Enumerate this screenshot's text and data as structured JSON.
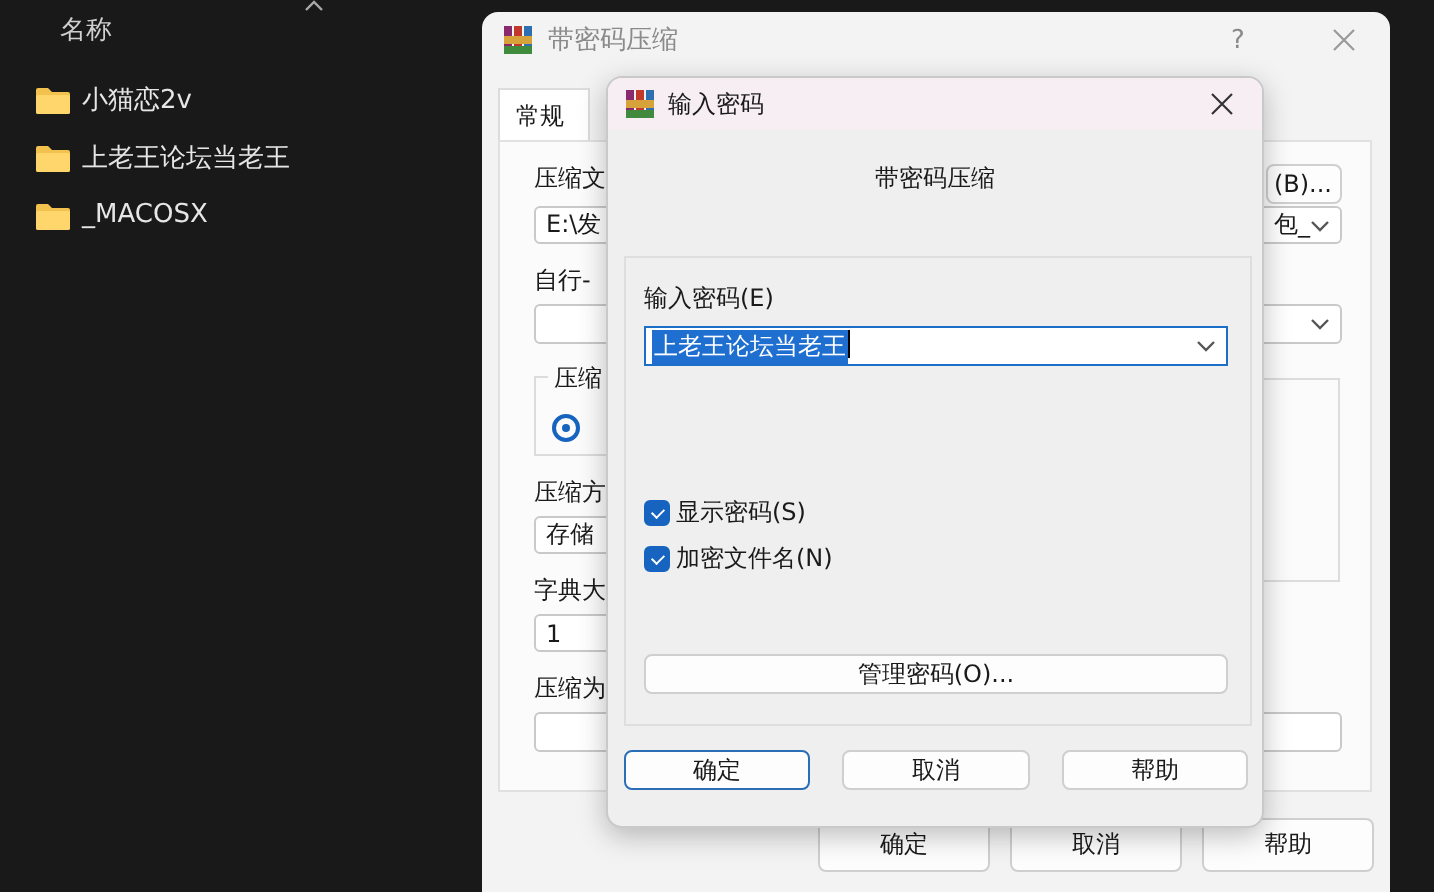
{
  "explorer": {
    "column_header": "名称",
    "items": [
      {
        "name": "小猫恋2v"
      },
      {
        "name": "上老王论坛当老王"
      },
      {
        "name": "_MACOSX"
      }
    ]
  },
  "background_window": {
    "title": "带密码压缩",
    "help": "?",
    "tabs": [
      {
        "label": "常规",
        "selected": true
      }
    ],
    "archive_name_label": "压缩文",
    "archive_path": "E:\\发",
    "browse_button": "(B)...",
    "archive_combo_tail": "包_",
    "profile_label": "自行-",
    "format_group_label": "压缩",
    "format_radio": {
      "selected": true
    },
    "method_label": "压缩方",
    "method_value": "存储",
    "dictionary_label": "字典大",
    "dictionary_value": "1",
    "split_label": "压缩为",
    "buttons": [
      "确定",
      "取消",
      "帮助"
    ]
  },
  "dialog": {
    "title": "输入密码",
    "heading": "带密码压缩",
    "password_label": "输入密码(E)",
    "password_value": "上老王论坛当老王",
    "password_selected": true,
    "options": [
      {
        "label": "显示密码(S)",
        "checked": true
      },
      {
        "label": "加密文件名(N)",
        "checked": true
      }
    ],
    "manage_button": "管理密码(O)...",
    "buttons": [
      {
        "label": "确定",
        "default": true
      },
      {
        "label": "取消",
        "default": false
      },
      {
        "label": "帮助",
        "default": false
      }
    ]
  }
}
